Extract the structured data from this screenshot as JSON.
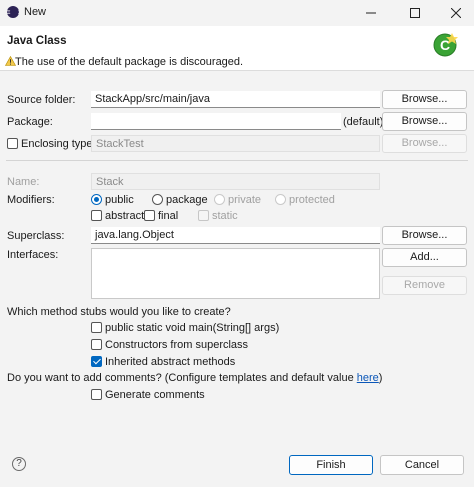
{
  "window": {
    "title": "New",
    "icon": "eclipse-icon",
    "minimize_icon": "minimize-icon",
    "maximize_icon": "maximize-icon",
    "close_icon": "close-icon"
  },
  "banner": {
    "title": "Java Class",
    "message": "The use of the default package is discouraged.",
    "message_icon": "warning-icon",
    "wizard_icon": "new-class-wizard-icon"
  },
  "form": {
    "source_folder": {
      "label": "Source folder:",
      "value": "StackApp/src/main/java",
      "button": "Browse..."
    },
    "package": {
      "label": "Package:",
      "value": "",
      "suffix": "(default)",
      "button": "Browse..."
    },
    "enclosing_type": {
      "label": "Enclosing type:",
      "value": "StackTest",
      "button": "Browse...",
      "checked": false
    },
    "name": {
      "label": "Name:",
      "value": "Stack"
    },
    "modifiers": {
      "label": "Modifiers:",
      "access": [
        {
          "label": "public",
          "selected": true
        },
        {
          "label": "package",
          "selected": false
        },
        {
          "label": "private",
          "selected": false
        },
        {
          "label": "protected",
          "selected": false
        }
      ],
      "flags": [
        {
          "label": "abstract",
          "checked": false
        },
        {
          "label": "final",
          "checked": false
        },
        {
          "label": "static",
          "checked": false
        }
      ]
    },
    "superclass": {
      "label": "Superclass:",
      "value": "java.lang.Object",
      "button": "Browse..."
    },
    "interfaces": {
      "label": "Interfaces:",
      "add_button": "Add...",
      "remove_button": "Remove"
    },
    "stubs": {
      "question": "Which method stubs would you like to create?",
      "options": [
        {
          "label": "public static void main(String[] args)",
          "checked": false
        },
        {
          "label": "Constructors from superclass",
          "checked": false
        },
        {
          "label": "Inherited abstract methods",
          "checked": true
        }
      ]
    },
    "comments": {
      "question_prefix": "Do you want to add comments? (Configure templates and default value ",
      "link": "here",
      "question_suffix": ")",
      "option": {
        "label": "Generate comments",
        "checked": false
      }
    }
  },
  "footer": {
    "help_icon": "help-icon",
    "help_glyph": "?",
    "finish": "Finish",
    "cancel": "Cancel"
  }
}
